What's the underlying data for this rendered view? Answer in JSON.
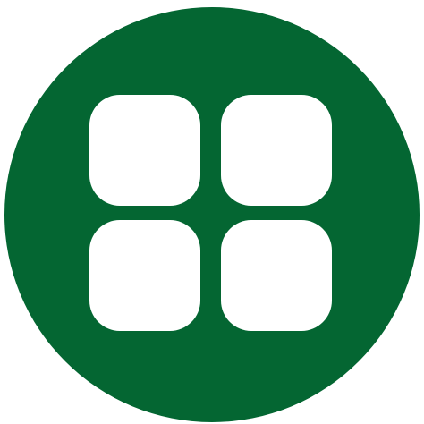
{
  "icon": {
    "name": "app-grid-icon",
    "label": "",
    "colors": {
      "circle": "#046632",
      "tiles": "#ffffff",
      "background": "#ffffff"
    },
    "tiles": [
      "top-left",
      "top-right",
      "bottom-left",
      "bottom-right"
    ]
  }
}
